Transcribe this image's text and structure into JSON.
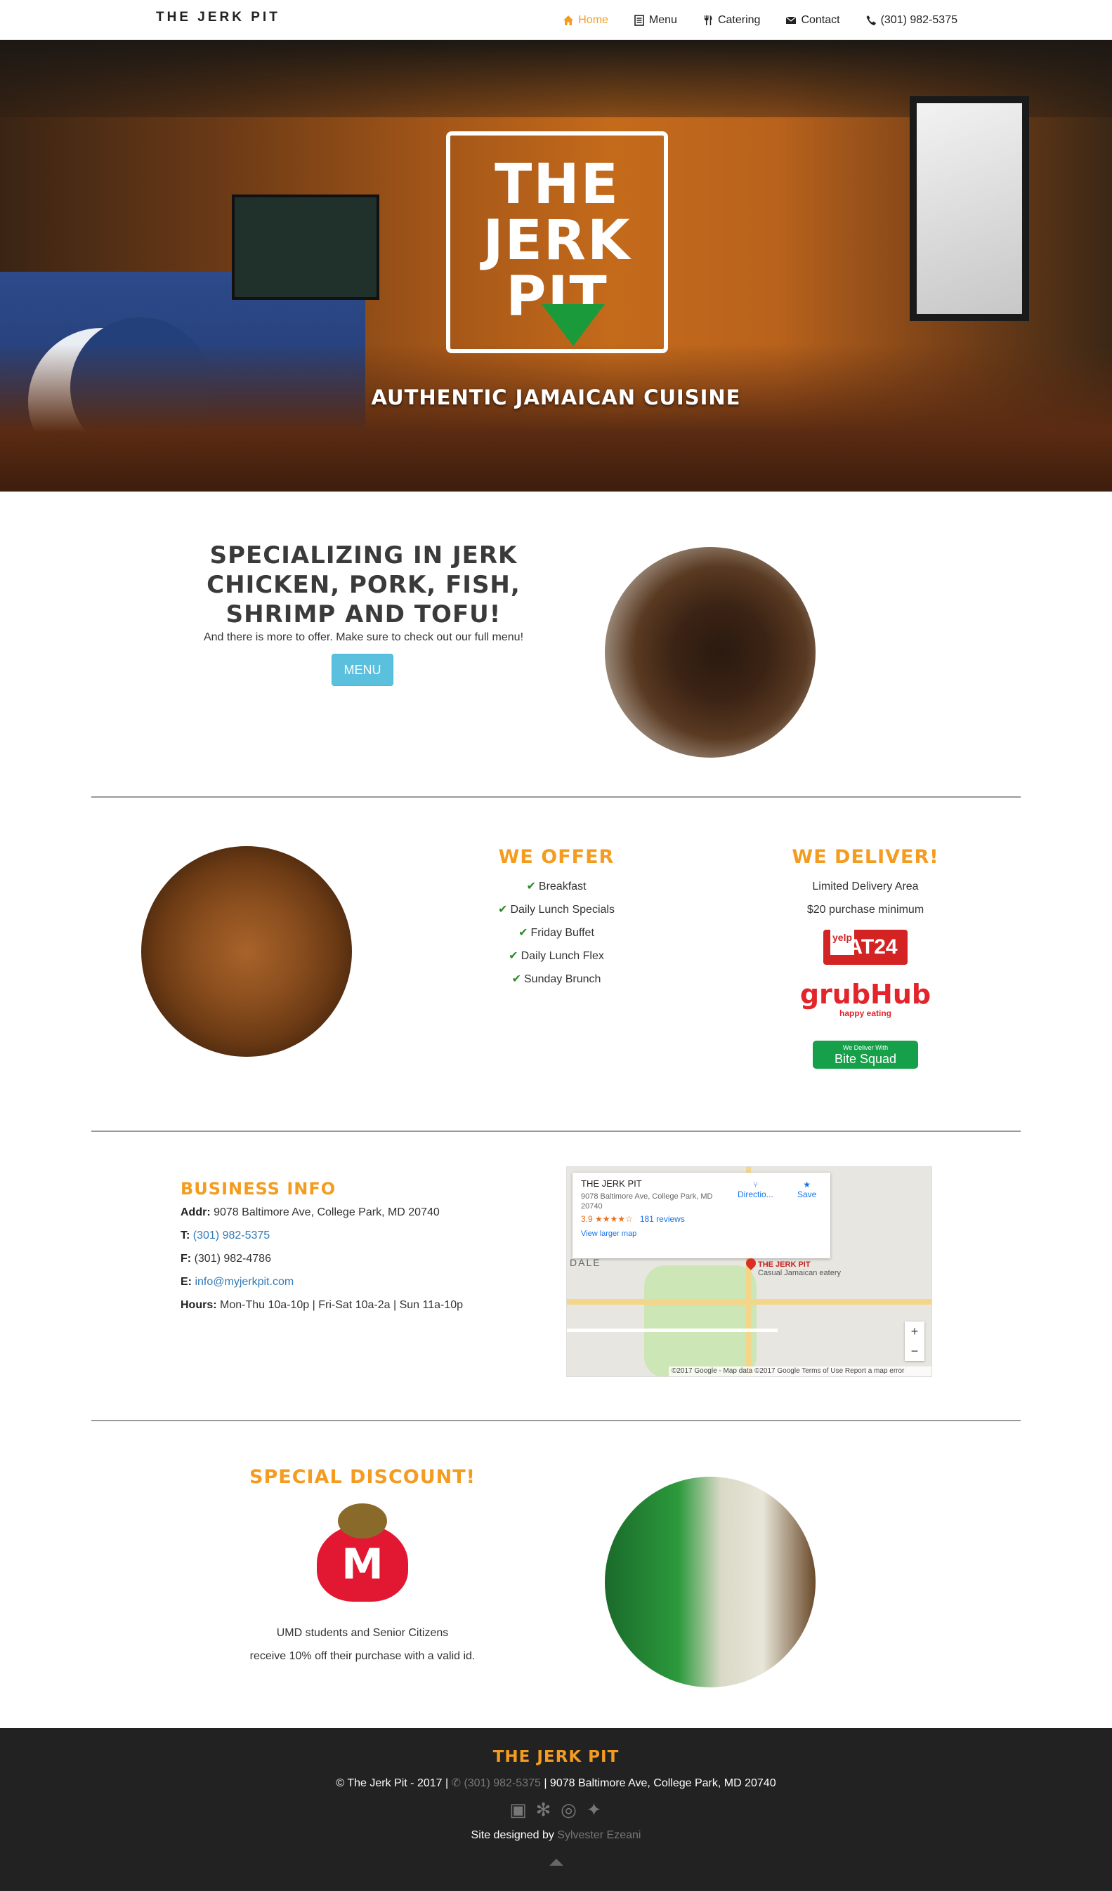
{
  "nav": {
    "brand": "THE JERK PIT",
    "items": [
      {
        "label": "Home",
        "icon": "home-icon"
      },
      {
        "label": "Menu",
        "icon": "list-icon"
      },
      {
        "label": "Catering",
        "icon": "cutlery-icon"
      },
      {
        "label": "Contact",
        "icon": "envelope-icon"
      },
      {
        "label": "(301) 982-5375",
        "icon": "phone-icon"
      }
    ]
  },
  "hero": {
    "logo": [
      "THE",
      "JERK",
      "PIT"
    ],
    "tagline": "AUTHENTIC JAMAICAN CUISINE"
  },
  "specializing": {
    "title": "SPECIALIZING IN JERK CHICKEN, PORK, FISH, SHRIMP AND TOFU!",
    "subtitle": "And there is more to offer. Make sure to check out our full menu!",
    "button": "MENU"
  },
  "offer": {
    "heading": "WE OFFER",
    "items": [
      "Breakfast",
      "Daily Lunch Specials",
      "Friday Buffet",
      "Daily Lunch Flex",
      "Sunday Brunch"
    ]
  },
  "deliver": {
    "heading": "WE DELIVER!",
    "lines": [
      "Limited Delivery Area",
      "$20 purchase minimum"
    ],
    "eat24": "EAT24",
    "eat24_yelp": "yelp",
    "grubhub": "grubHub",
    "grubhub_sub": "happy eating",
    "bitesquad_small": "We Deliver With",
    "bitesquad": "Bite Squad"
  },
  "business": {
    "heading": "BUSINESS INFO",
    "addr_label": "Addr:",
    "addr": "9078 Baltimore Ave, College Park, MD 20740",
    "tel_label": "T:",
    "tel": "(301) 982-5375",
    "fax_label": "F:",
    "fax": "(301) 982-4786",
    "email_label": "E:",
    "email": "info@myjerkpit.com",
    "hours_label": "Hours:",
    "hours": "Mon-Thu 10a-10p | Fri-Sat 10a-2a | Sun 11a-10p"
  },
  "map": {
    "title": "THE JERK PIT",
    "address": "9078 Baltimore Ave, College Park, MD 20740",
    "rating": "3.9 ★★★★☆",
    "reviews": "181 reviews",
    "larger": "View larger map",
    "directions": "Directio...",
    "save": "Save",
    "pin_name": "THE JERK PIT",
    "pin_desc": "Casual Jamaican eatery",
    "area": "DALE",
    "footer": "©2017 Google - Map data ©2017 Google   Terms of Use   Report a map error"
  },
  "discount": {
    "heading": "SPECIAL DISCOUNT!",
    "line1": "UMD students and Senior Citizens",
    "line2": "receive 10% off their purchase with a valid id."
  },
  "footer": {
    "title": "THE JERK PIT",
    "copyright": "The Jerk Pit - 2017 |",
    "phone": "(301) 982-5375",
    "address": "| 9078 Baltimore Ave, College Park, MD 20740",
    "designed_prefix": "Site designed by",
    "designer": "Sylvester Ezeani"
  },
  "colors": {
    "accent": "#f39c1f",
    "button": "#5bc0de",
    "footer_bg": "#222222",
    "link": "#337ab7"
  }
}
